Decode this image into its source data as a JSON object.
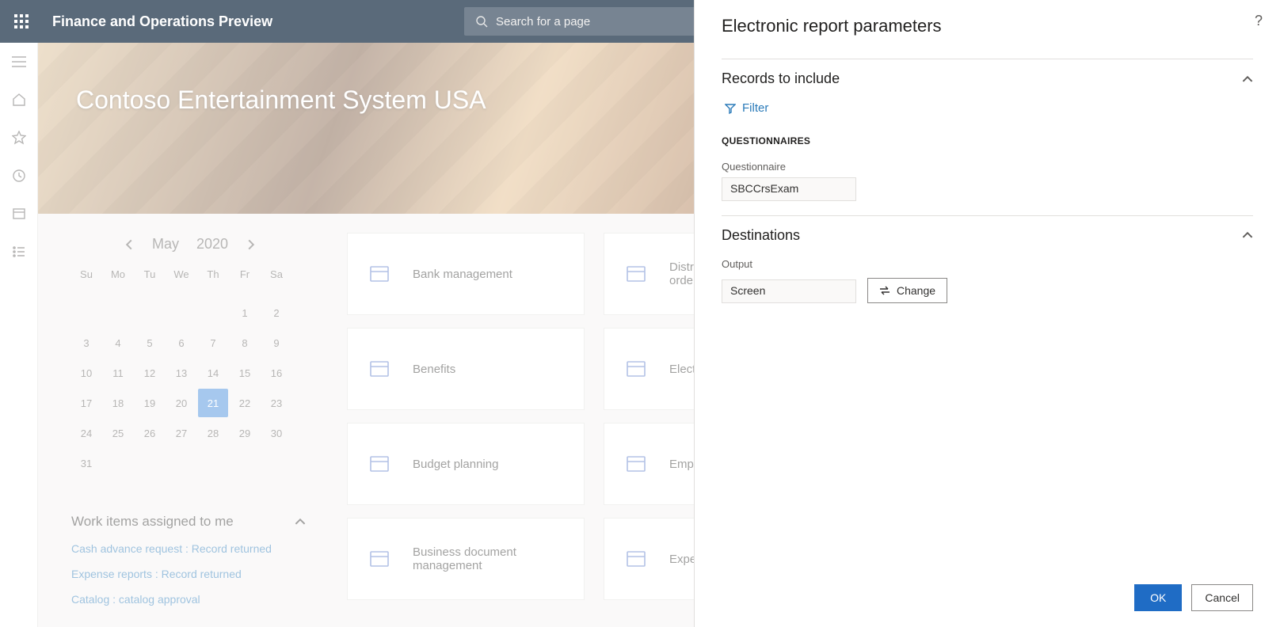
{
  "header": {
    "app_title": "Finance and Operations Preview",
    "search_placeholder": "Search for a page"
  },
  "hero": {
    "company": "Contoso Entertainment System USA"
  },
  "calendar": {
    "month": "May",
    "year": "2020",
    "dow": [
      "Su",
      "Mo",
      "Tu",
      "We",
      "Th",
      "Fr",
      "Sa"
    ],
    "weeks": [
      [
        "",
        "",
        "",
        "",
        "",
        "1",
        "2"
      ],
      [
        "3",
        "4",
        "5",
        "6",
        "7",
        "8",
        "9"
      ],
      [
        "10",
        "11",
        "12",
        "13",
        "14",
        "15",
        "16"
      ],
      [
        "17",
        "18",
        "19",
        "20",
        "21",
        "22",
        "23"
      ],
      [
        "24",
        "25",
        "26",
        "27",
        "28",
        "29",
        "30"
      ],
      [
        "31",
        "",
        "",
        "",
        "",
        "",
        ""
      ]
    ],
    "selected": "21"
  },
  "workitems": {
    "title": "Work items assigned to me",
    "items": [
      "Cash advance request : Record returned",
      "Expense reports : Record returned",
      "Catalog : catalog approval"
    ]
  },
  "tiles": [
    {
      "label": "Bank management"
    },
    {
      "label": "Distributed hybrid topology order management"
    },
    {
      "label": "Benefits"
    },
    {
      "label": "Electronic reporting"
    },
    {
      "label": "Budget planning"
    },
    {
      "label": "Employee self service"
    },
    {
      "label": "Business document management"
    },
    {
      "label": "Expense management"
    }
  ],
  "panel": {
    "title": "Electronic report parameters",
    "records": {
      "heading": "Records to include",
      "filter": "Filter",
      "group_label": "QUESTIONNAIRES",
      "field_label": "Questionnaire",
      "field_value": "SBCCrsExam"
    },
    "destinations": {
      "heading": "Destinations",
      "output_label": "Output",
      "output_value": "Screen",
      "change": "Change"
    },
    "ok": "OK",
    "cancel": "Cancel"
  }
}
